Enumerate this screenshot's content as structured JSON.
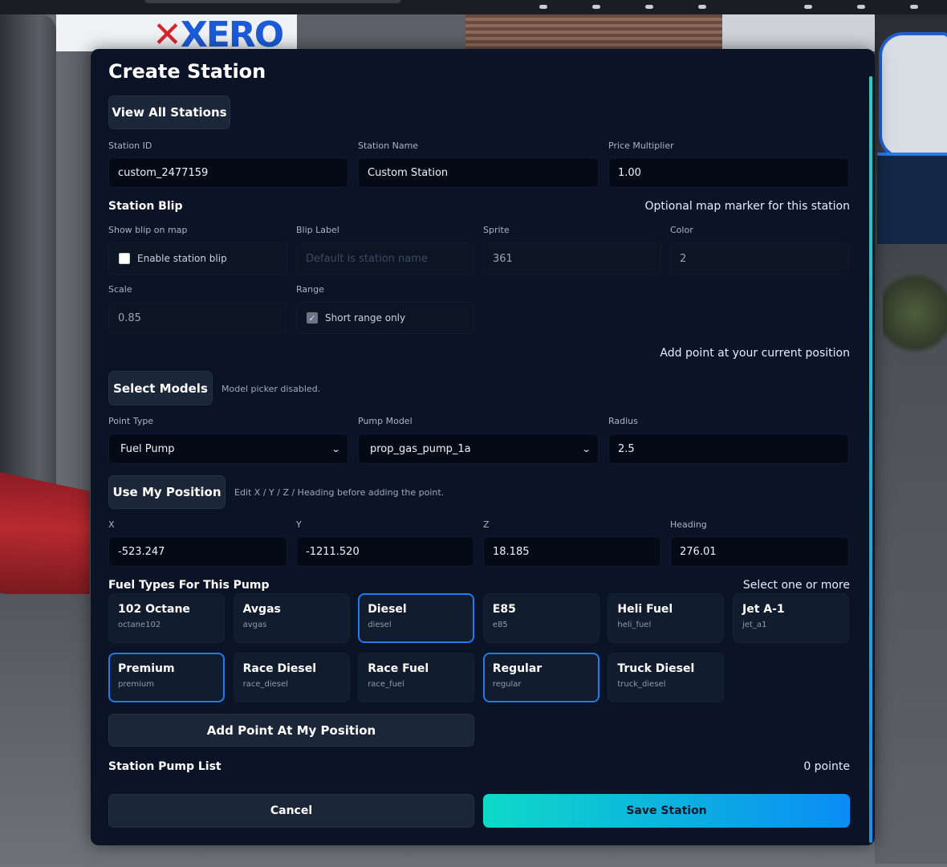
{
  "background": {
    "logo": "XERO"
  },
  "panel": {
    "title": "Create Station",
    "view_all_label": "View All Stations",
    "fields": {
      "station_id": {
        "label": "Station ID",
        "value": "custom_2477159"
      },
      "station_name": {
        "label": "Station Name",
        "value": "Custom Station"
      },
      "price_multiplier": {
        "label": "Price Multiplier",
        "value": "1.00"
      }
    },
    "blip": {
      "heading": "Station Blip",
      "hint": "Optional map marker for this station",
      "show_label": "Show blip on map",
      "enable_label": "Enable station blip",
      "enabled": false,
      "blip_label": {
        "label": "Blip Label",
        "placeholder": "Default is station name"
      },
      "sprite": {
        "label": "Sprite",
        "value": "361"
      },
      "color": {
        "label": "Color",
        "value": "2"
      },
      "scale": {
        "label": "Scale",
        "value": "0.85"
      },
      "range": {
        "label": "Range",
        "option": "Short range only",
        "checked": true
      }
    },
    "pump": {
      "heading": {
        "label": "Heading",
        "value": "276.01"
      },
      "hint": "Add point at your current position",
      "select_models_label": "Select Models",
      "picker_note": "Model picker disabled.",
      "point_type": {
        "label": "Point Type",
        "value": "Fuel Pump"
      },
      "pump_model": {
        "label": "Pump Model",
        "value": "prop_gas_pump_1a"
      },
      "radius": {
        "label": "Radius",
        "value": "2.5"
      },
      "use_position_label": "Use My Position",
      "position_note": "Edit X / Y / Z / Heading before adding the point.",
      "x": {
        "label": "X",
        "value": "-523.247"
      },
      "y": {
        "label": "Y",
        "value": "-1211.520"
      },
      "z": {
        "label": "Z",
        "value": "18.185"
      }
    },
    "fuel_types": {
      "heading": "Fuel Types For This Pump",
      "hint": "Select one or more",
      "items": [
        {
          "name": "102 Octane",
          "code": "octane102",
          "selected": false
        },
        {
          "name": "Avgas",
          "code": "avgas",
          "selected": false
        },
        {
          "name": "Diesel",
          "code": "diesel",
          "selected": true
        },
        {
          "name": "E85",
          "code": "e85",
          "selected": false
        },
        {
          "name": "Heli Fuel",
          "code": "heli_fuel",
          "selected": false
        },
        {
          "name": "Jet A-1",
          "code": "jet_a1",
          "selected": false
        },
        {
          "name": "Premium",
          "code": "premium",
          "selected": true
        },
        {
          "name": "Race Diesel",
          "code": "race_diesel",
          "selected": false
        },
        {
          "name": "Race Fuel",
          "code": "race_fuel",
          "selected": false
        },
        {
          "name": "Regular",
          "code": "regular",
          "selected": true
        },
        {
          "name": "Truck Diesel",
          "code": "truck_diesel",
          "selected": false
        }
      ]
    },
    "add_point_label": "Add Point At My Position",
    "pump_list": {
      "heading": "Station Pump List",
      "count": "0 pointe"
    },
    "cancel_label": "Cancel",
    "save_label": "Save Station"
  },
  "colors": {
    "panel_bg": "#0a1426",
    "accent_teal": "#0fd9c8",
    "accent_blue": "#0a8df5",
    "selected_border": "#1e7cf0"
  }
}
